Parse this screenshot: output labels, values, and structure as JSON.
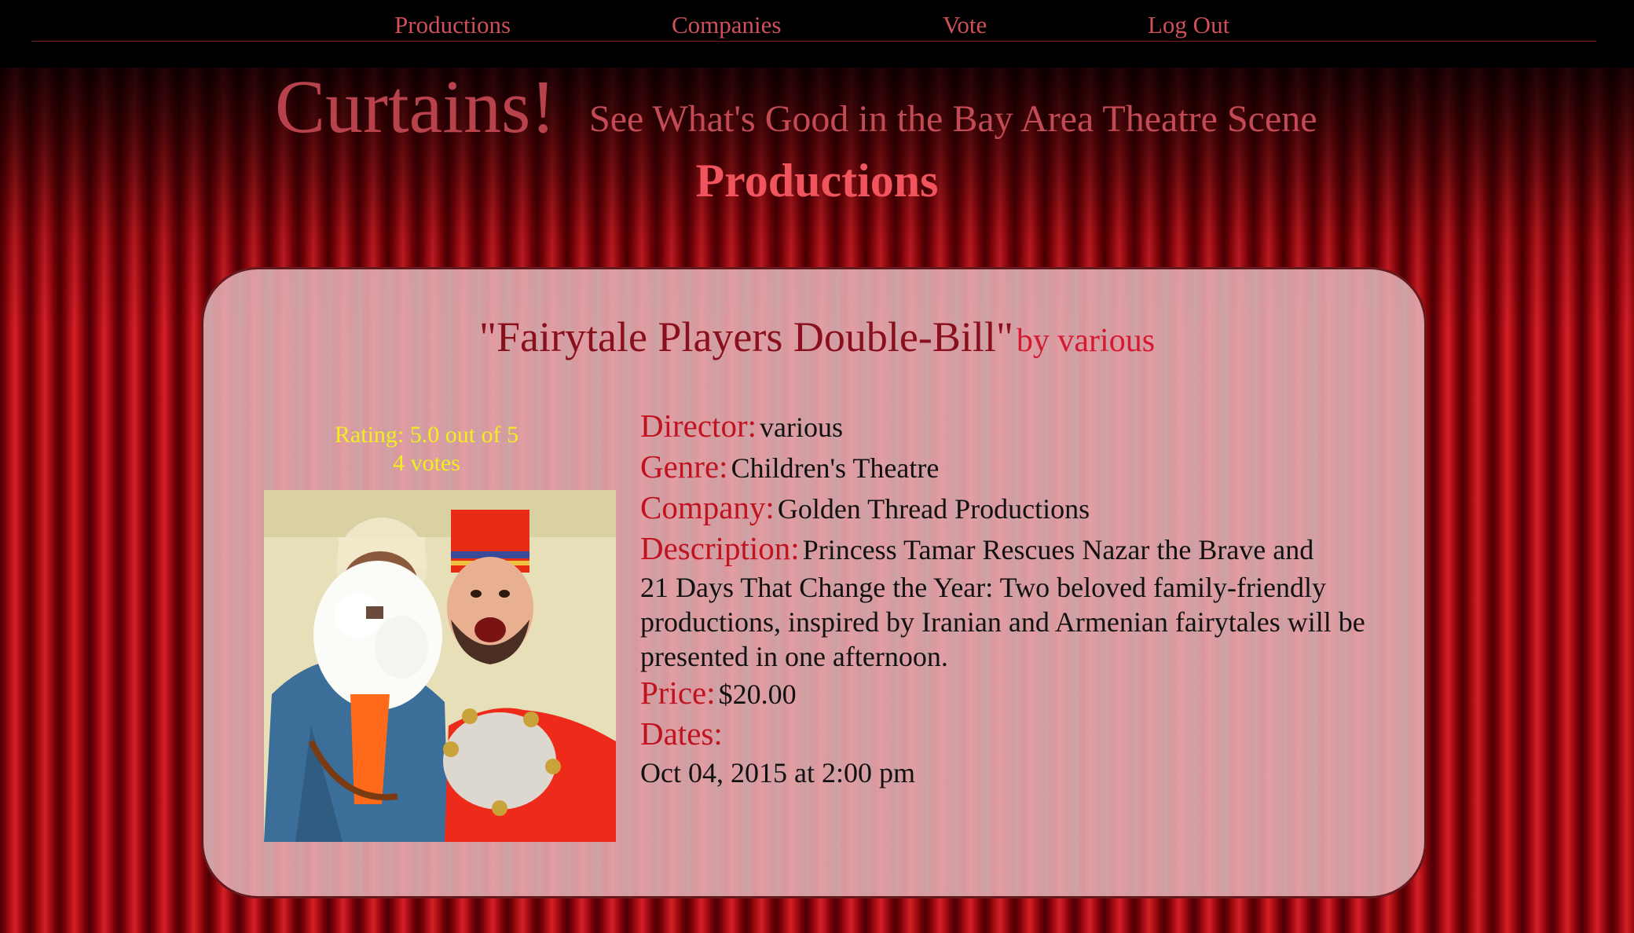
{
  "nav": {
    "items": [
      {
        "label": "Productions"
      },
      {
        "label": "Companies"
      },
      {
        "label": "Vote"
      },
      {
        "label": "Log Out"
      }
    ]
  },
  "header": {
    "brand": "Curtains!",
    "tagline": "See What's Good in the Bay Area Theatre Scene"
  },
  "page": {
    "title": "Productions"
  },
  "production": {
    "title": "\"Fairytale Players Double-Bill\"",
    "author": "by various",
    "rating_text": "Rating: 5.0 out of 5",
    "votes_text": "4 votes",
    "director_label": "Director:",
    "director": "various",
    "genre_label": "Genre:",
    "genre": "Children's Theatre",
    "company_label": "Company:",
    "company": "Golden Thread Productions",
    "description_label": "Description:",
    "description_line1": "Princess Tamar Rescues Nazar the Brave and",
    "description_rest": "21 Days That Change the Year: Two beloved family-friendly productions, inspired by Iranian and Armenian fairytales will be presented in one afternoon.",
    "price_label": "Price:",
    "price": "$20.00",
    "dates_label": "Dates:",
    "dates": [
      "Oct 04, 2015 at 2:00 pm"
    ]
  },
  "colors": {
    "nav_link": "#d0505a",
    "brand": "#b7424c",
    "page_title": "#f0555e",
    "label": "#c1121f",
    "rating": "#f2ef1e"
  }
}
